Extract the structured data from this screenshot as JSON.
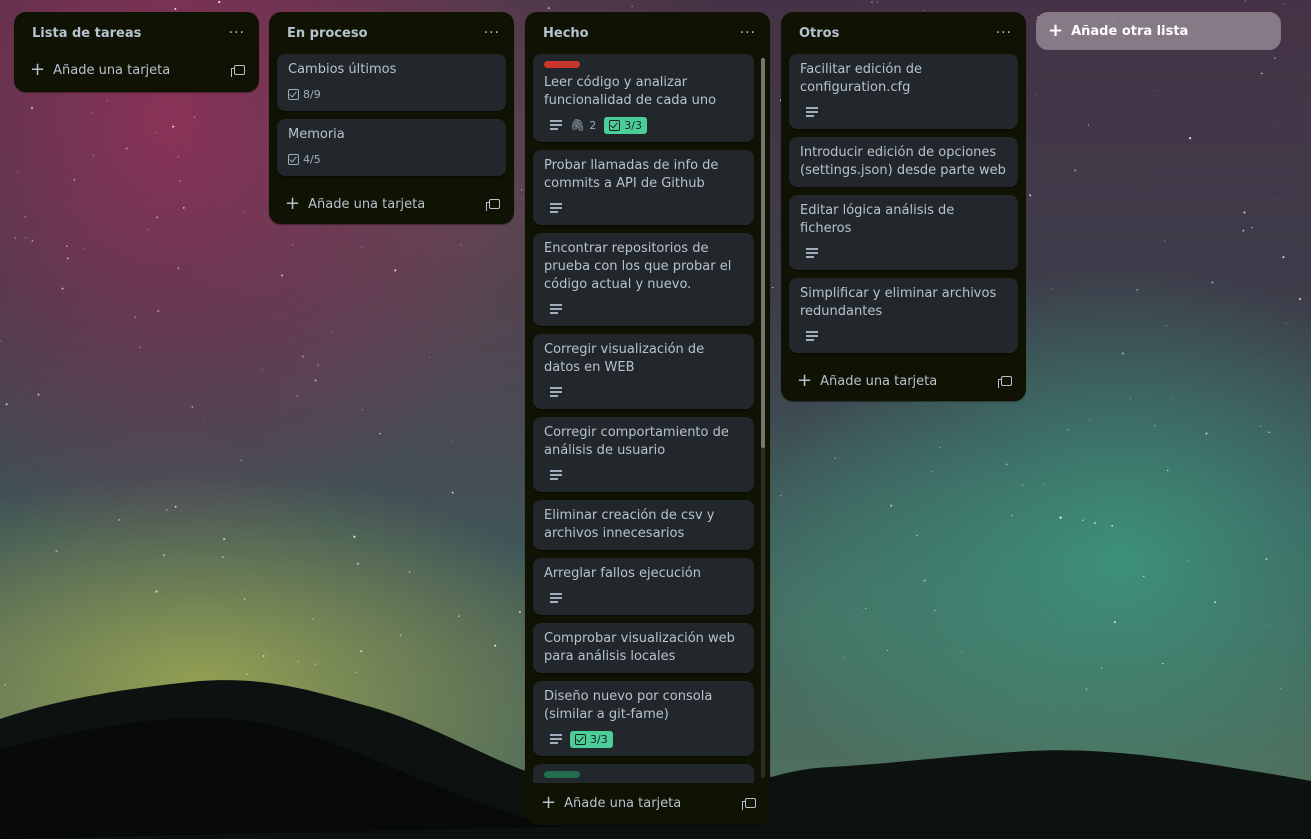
{
  "colors": {
    "list_bg": "#101204",
    "card_bg": "#22272b",
    "text": "#b6c2cf",
    "done_badge": "#4bce97",
    "label_red": "#c9372c",
    "label_green": "#216e4e"
  },
  "board": {
    "add_list_label": "Añade otra lista",
    "add_card_label": "Añade una tarjeta",
    "menu_label": "···",
    "lists": [
      {
        "title": "Lista de tareas",
        "cards": []
      },
      {
        "title": "En proceso",
        "cards": [
          {
            "title": "Cambios últimos",
            "checklist": "8/9"
          },
          {
            "title": "Memoria",
            "checklist": "4/5"
          }
        ]
      },
      {
        "title": "Hecho",
        "cards": [
          {
            "title": "Leer código y analizar funcionalidad de cada uno",
            "label": "red",
            "attachments": "2",
            "checklist": "3/3"
          },
          {
            "title": "Probar llamadas de info de commits a API de Github"
          },
          {
            "title": "Encontrar repositorios de prueba con los que probar el código actual y nuevo."
          },
          {
            "title": "Corregir visualización de datos en WEB"
          },
          {
            "title": "Corregir comportamiento de análisis de usuario"
          },
          {
            "title": "Eliminar creación de csv y archivos innecesarios"
          },
          {
            "title": "Arreglar fallos ejecución"
          },
          {
            "title": "Comprobar visualización web para análisis locales"
          },
          {
            "title": "Diseño nuevo por consola (similar a git-fame)",
            "checklist": "3/3"
          },
          {
            "title": "",
            "label": "green"
          }
        ]
      },
      {
        "title": "Otros",
        "cards": [
          {
            "title": "Facilitar edición de configuration.cfg"
          },
          {
            "title": "Introducir edición de opciones (settings.json) desde parte web"
          },
          {
            "title": "Editar lógica análisis de ficheros"
          },
          {
            "title": "Simplificar y eliminar archivos redundantes"
          }
        ]
      }
    ]
  }
}
